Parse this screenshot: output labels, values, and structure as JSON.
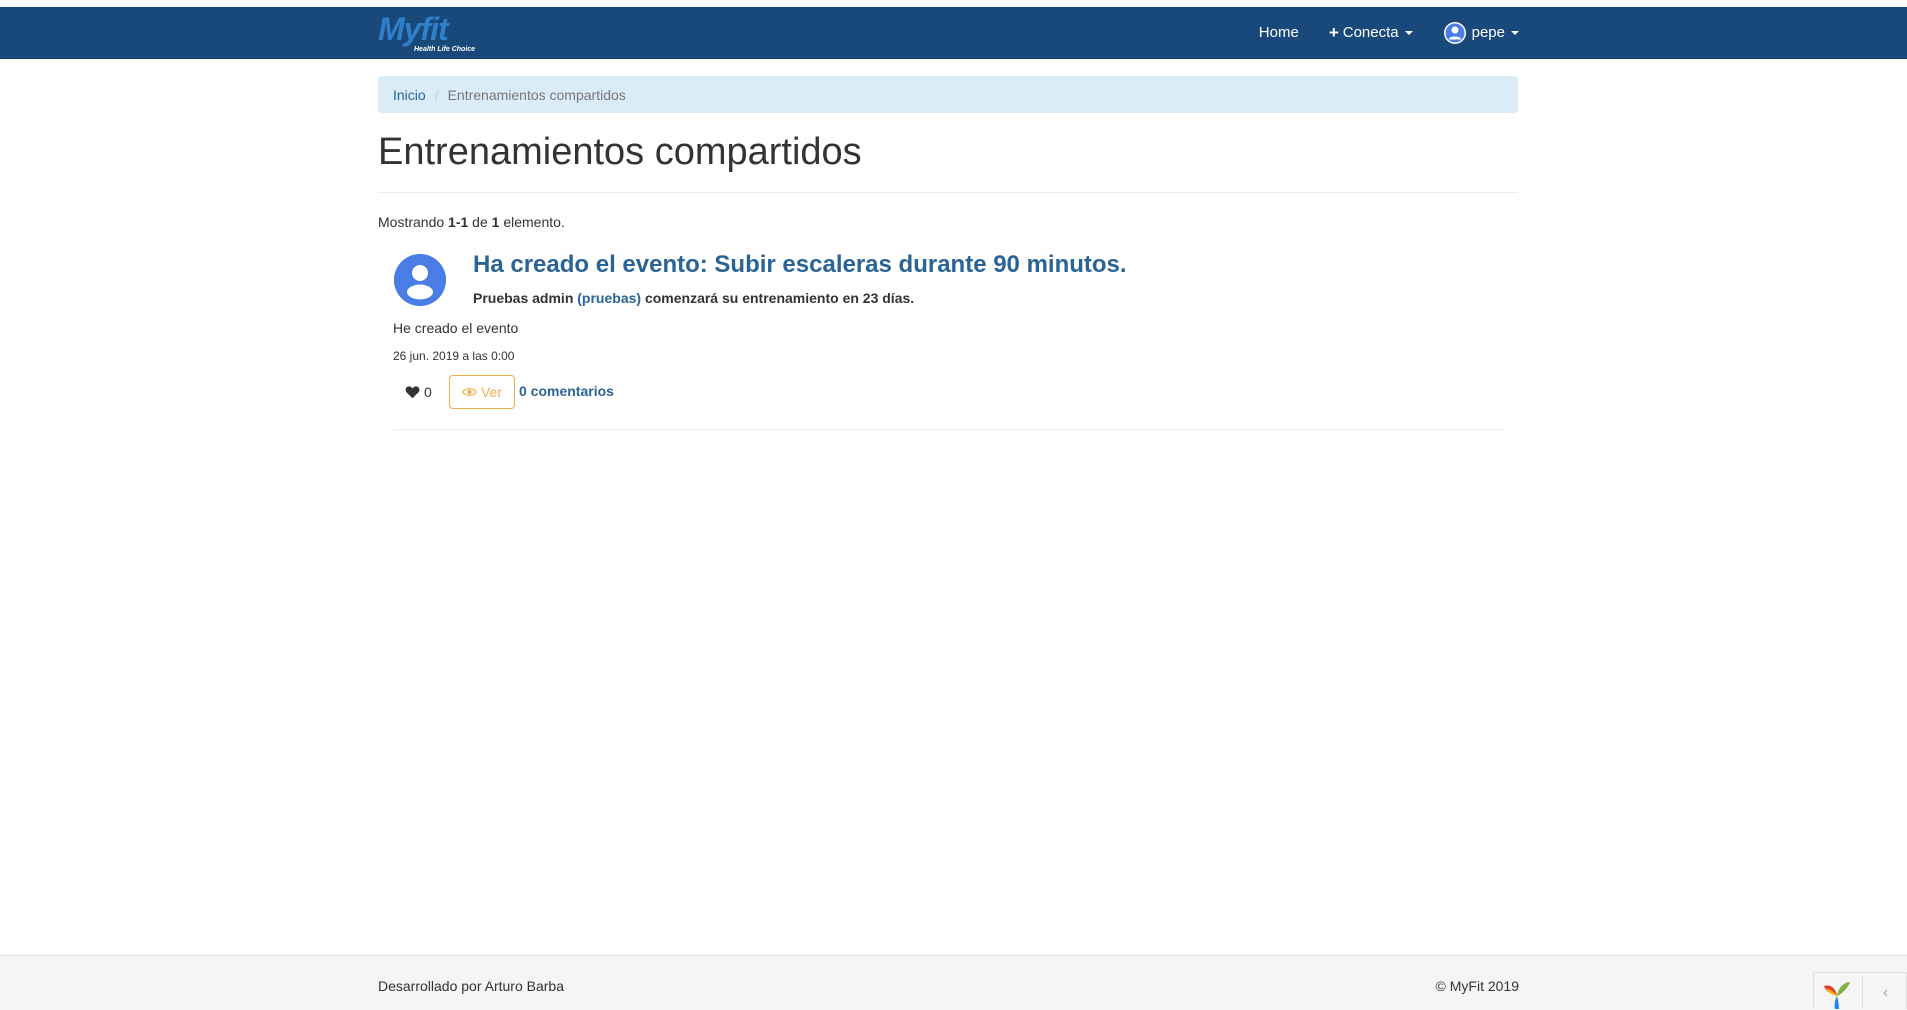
{
  "navbar": {
    "brand": {
      "logo_text": "Myfit",
      "tagline": "Health Life Choice"
    },
    "items": [
      {
        "label": "Home"
      },
      {
        "label": "Conecta"
      },
      {
        "label": "pepe"
      }
    ]
  },
  "breadcrumb": {
    "home": "Inicio",
    "current": "Entrenamientos compartidos"
  },
  "page": {
    "title": "Entrenamientos compartidos",
    "summary": {
      "prefix": "Mostrando ",
      "range": "1-1",
      "middle": " de ",
      "total": "1",
      "suffix": " elemento."
    }
  },
  "post": {
    "title": "Ha creado el evento: Subir escaleras durante 90 minutos.",
    "author": "Pruebas admin",
    "username": "(pruebas)",
    "meta_suffix": "comenzará su entrenamiento en 23 días.",
    "body": "He creado el evento",
    "date": "26 jun. 2019 a las 0:00",
    "likes": "0",
    "view_label": "Ver",
    "comments": "0 comentarios"
  },
  "footer": {
    "left": "Desarrollado por Arturo Barba",
    "right": "© MyFit 2019"
  },
  "debug": {
    "toggle_glyph": "‹"
  },
  "colors": {
    "navbar": "#19497a",
    "link": "#2a6496",
    "warning": "#f0ad4e",
    "breadcrumb_bg": "#d9ecf7"
  }
}
